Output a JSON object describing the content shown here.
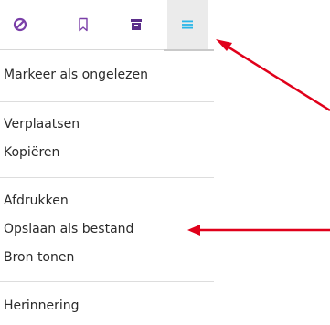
{
  "toolbar": {
    "buttons": [
      {
        "icon": "block-icon",
        "color": "#7a3fa8",
        "active": false
      },
      {
        "icon": "bookmark-icon",
        "color": "#7a3fa8",
        "active": false
      },
      {
        "icon": "archive-icon",
        "color": "#5b2d8a",
        "active": false
      },
      {
        "icon": "menu-icon",
        "color": "#29b6e8",
        "active": true
      }
    ]
  },
  "menu": {
    "items": [
      {
        "label": "Markeer als ongelezen"
      },
      {
        "label": "Verplaatsen"
      },
      {
        "label": "Kopiëren"
      },
      {
        "label": "Afdrukken"
      },
      {
        "label": "Opslaan als bestand"
      },
      {
        "label": "Bron tonen"
      },
      {
        "label": "Herinnering"
      }
    ]
  },
  "annotations": {
    "arrow_color": "#e0001a"
  }
}
